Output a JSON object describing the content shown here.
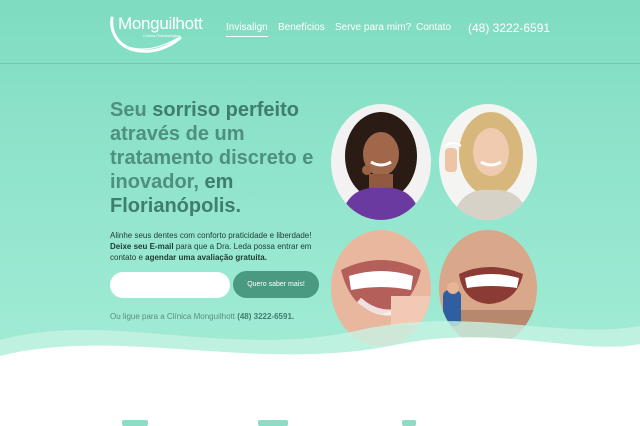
{
  "header": {
    "logo_name": "Monguilhott",
    "logo_sub": "Clínica Odontológica",
    "nav": [
      {
        "label": "Invisalign",
        "active": true
      },
      {
        "label": "Benefícios",
        "active": false
      },
      {
        "label": "Serve para mim?",
        "active": false
      },
      {
        "label": "Contato",
        "active": false
      }
    ],
    "phone": "(48) 3222-6591"
  },
  "hero": {
    "headline_parts": {
      "p1": "Seu ",
      "b1": "sorriso perfeito",
      "p2": " através de um tratamento discreto e inovador, ",
      "b2": "em Florianópolis."
    },
    "desc_parts": {
      "p1": "Alinhe seus dentes com conforto praticidade e liberdade! ",
      "b1": "Deixe seu E-mail",
      "p2": " para que a Dra. Leda possa entrar em contato e ",
      "b2": "agendar uma avaliação gratuita."
    },
    "email_placeholder": "",
    "cta_label": "Quero saber mais!",
    "call_text": "Ou ligue para a Clínica Monguilhott ",
    "call_phone": "(48) 3222-6591."
  },
  "photos": [
    {
      "name": "woman-curly-hair-photo"
    },
    {
      "name": "woman-blonde-holding-aligner-photo"
    },
    {
      "name": "smile-inserting-aligner-photo"
    },
    {
      "name": "man-smile-aligner-photo"
    }
  ],
  "colors": {
    "hero_top": "#7fdcc0",
    "hero_bottom": "#a3ecd6",
    "accent": "#4a9a82",
    "headline": "#4e8f7e"
  }
}
